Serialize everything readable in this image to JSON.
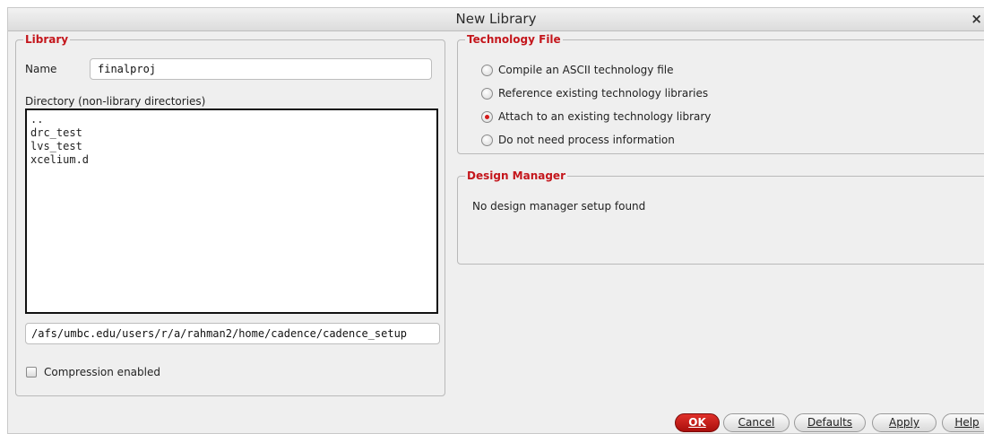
{
  "window": {
    "title": "New Library",
    "close_glyph": "×"
  },
  "library": {
    "legend": "Library",
    "name_label": "Name",
    "name_value": "finalproj",
    "directory_label": "Directory (non-library directories)",
    "directory_items": [
      "..",
      "drc_test",
      "lvs_test",
      "xcelium.d"
    ],
    "path_value": "/afs/umbc.edu/users/r/a/rahman2/home/cadence/cadence_setup",
    "compression_label": "Compression enabled",
    "compression_checked": false
  },
  "technology_file": {
    "legend": "Technology File",
    "options": [
      {
        "label": "Compile an ASCII technology file",
        "selected": false
      },
      {
        "label": "Reference existing technology libraries",
        "selected": false
      },
      {
        "label": "Attach to an existing technology library",
        "selected": true
      },
      {
        "label": "Do not need process information",
        "selected": false
      }
    ]
  },
  "design_manager": {
    "legend": "Design Manager",
    "message": "No design manager setup found"
  },
  "buttons": {
    "ok": "OK",
    "cancel": "Cancel",
    "defaults": "Defaults",
    "apply": "Apply",
    "help": "Help"
  },
  "colors": {
    "accent_red": "#c4161c",
    "ok_button": "#c2201b"
  }
}
